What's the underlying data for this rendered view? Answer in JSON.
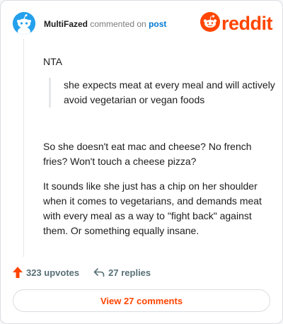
{
  "comment": {
    "username": "MultiFazed",
    "commented_on": "commented on",
    "post_link": "post",
    "body": {
      "verdict": "NTA",
      "quote": "she expects meat at every meal and will actively avoid vegetarian or vegan foods",
      "paragraph_2": "So she doesn't eat mac and cheese? No french fries? Won't touch a cheese pizza?",
      "paragraph_3": "It sounds like she just has a chip on her shoulder when it comes to vegetarians, and demands meat with every meal as a way to \"fight back\" against them. Or something equally insane."
    }
  },
  "brand": {
    "logo_text": "reddit",
    "accent_color": "#ff4500",
    "icons": [
      "snoo-avatar-icon",
      "reddit-logo-icon"
    ]
  },
  "actions": {
    "upvotes": "323 upvotes",
    "replies": "27 replies",
    "icons": [
      "upvote-arrow-icon",
      "reply-arrow-icon"
    ]
  },
  "view_comments_label": "View 27 comments"
}
